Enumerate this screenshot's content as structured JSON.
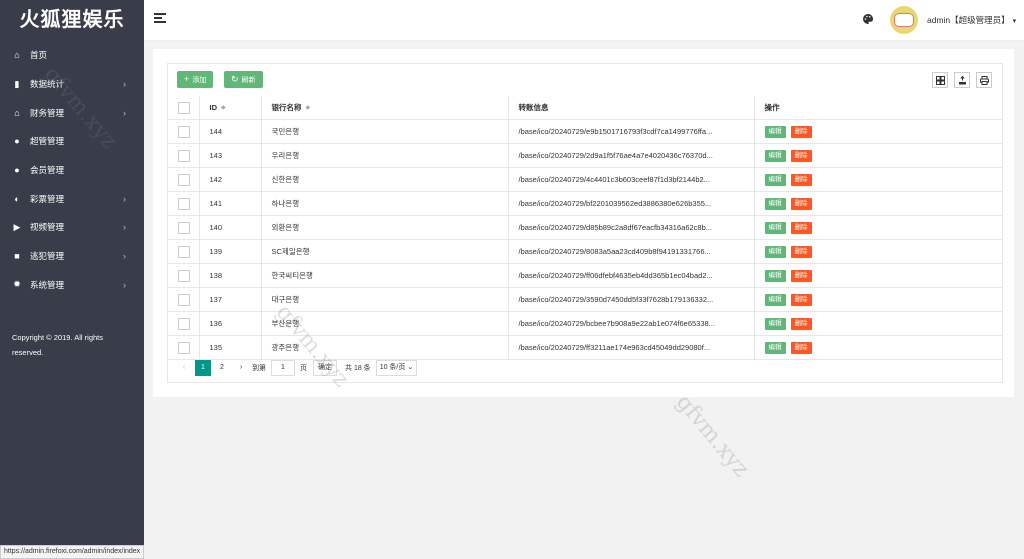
{
  "brand": "火狐狸娱乐",
  "sidebar": {
    "items": [
      {
        "label": "首页",
        "icon": "home-icon",
        "glyph": "⌂",
        "has_sub": false
      },
      {
        "label": "数据统计",
        "icon": "bar-chart-icon",
        "glyph": "▮",
        "has_sub": true
      },
      {
        "label": "财务管理",
        "icon": "bank-icon",
        "glyph": "⌂",
        "has_sub": true
      },
      {
        "label": "超管管理",
        "icon": "user-icon",
        "glyph": "●",
        "has_sub": false
      },
      {
        "label": "会员管理",
        "icon": "users-icon",
        "glyph": "●",
        "has_sub": false
      },
      {
        "label": "彩票管理",
        "icon": "gamepad-icon",
        "glyph": "◐",
        "has_sub": true
      },
      {
        "label": "视频管理",
        "icon": "video-icon",
        "glyph": "▶",
        "has_sub": true
      },
      {
        "label": "逃犯管理",
        "icon": "camera-icon",
        "glyph": "■",
        "has_sub": true
      },
      {
        "label": "系统管理",
        "icon": "gear-icon",
        "glyph": "✹",
        "has_sub": true
      }
    ],
    "arrow": "›",
    "copyright": "Copyright © 2019. All rights reserved."
  },
  "header": {
    "user_label": "admin【超级管理员】",
    "caret": "▾"
  },
  "toolbar": {
    "add_label": "添加",
    "add_glyph": "+",
    "refresh_label": "刷新",
    "refresh_glyph": "↻"
  },
  "table": {
    "headers": {
      "id": "ID",
      "bank": "银行名称",
      "info": "转账信息",
      "ops": "操作"
    },
    "sort_glyph": "◆",
    "edit_label": "编辑",
    "delete_label": "删除",
    "rows": [
      {
        "id": "144",
        "bank": "국민은행",
        "info": "/base/ico/20240729/e9b1501716793f3cdf7ca1499776ffa..."
      },
      {
        "id": "143",
        "bank": "우리은행",
        "info": "/base/ico/20240729/2d9a1f5f76ae4a7e4020436c76370d..."
      },
      {
        "id": "142",
        "bank": "신한은행",
        "info": "/base/ico/20240729/4c4401c3b603ceef87f1d3bf2144b2..."
      },
      {
        "id": "141",
        "bank": "하나은행",
        "info": "/base/ico/20240729/bf2201039562ed3886380e626b355..."
      },
      {
        "id": "140",
        "bank": "외환은행",
        "info": "/base/ico/20240729/d85b89c2a8df67eacfb34316a62c8b..."
      },
      {
        "id": "139",
        "bank": "SC제일은행",
        "info": "/base/ico/20240729/8083a5aa23cd409b8f94191331766..."
      },
      {
        "id": "138",
        "bank": "한국씨티은행",
        "info": "/base/ico/20240729/ff06dfebf4635eb4dd365b1ec04bad2..."
      },
      {
        "id": "137",
        "bank": "대구은행",
        "info": "/base/ico/20240729/3590d7450dd5f33f7628b179136332..."
      },
      {
        "id": "136",
        "bank": "부산은행",
        "info": "/base/ico/20240729/bcbee7b908a9e22ab1e074f6e65338..."
      },
      {
        "id": "135",
        "bank": "광주은행",
        "info": "/base/ico/20240729/ff3211ae174e963cd45049dd29080f..."
      }
    ]
  },
  "pager": {
    "prev": "‹",
    "pages": [
      "1",
      "2"
    ],
    "next": "›",
    "goto_label": "到第",
    "goto_value": "1",
    "page_unit": "页",
    "confirm": "确定",
    "total": "共 18 条",
    "per_page": "10 条/页",
    "per_page_caret": "⌄"
  },
  "status_url": "https://admin.firefoxi.com/admin/index/index",
  "watermark": "gfvm.xyz",
  "colors": {
    "sidebar": "#393d49",
    "green": "#5fb878",
    "red": "#ff5722",
    "teal": "#009688"
  }
}
